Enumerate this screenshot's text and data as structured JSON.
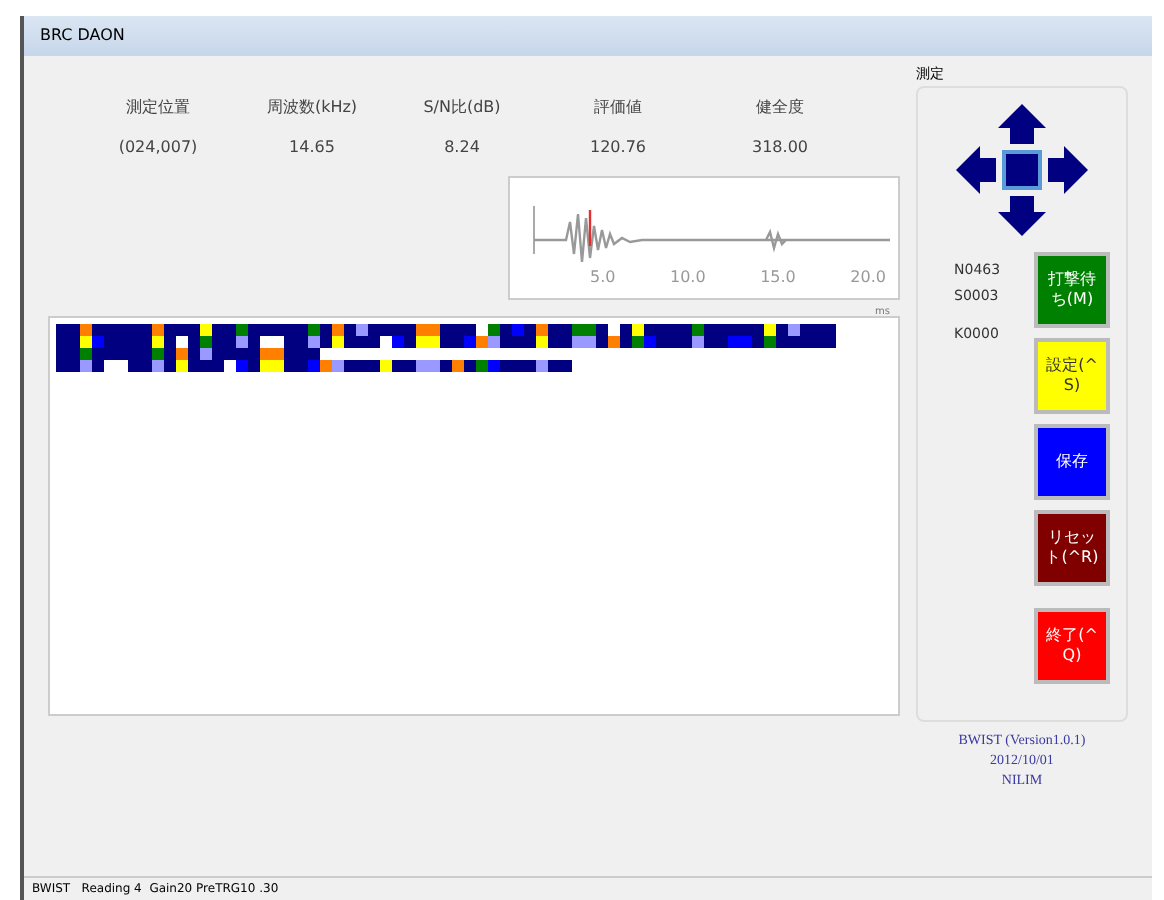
{
  "window": {
    "title": "BRC DAON"
  },
  "measurements": [
    {
      "label": "測定位置",
      "value": "(024,007)"
    },
    {
      "label": "周波数(kHz)",
      "value": "14.65"
    },
    {
      "label": "S/N比(dB)",
      "value": "8.24"
    },
    {
      "label": "評価値",
      "value": "120.76"
    },
    {
      "label": "健全度",
      "value": "318.00"
    }
  ],
  "waveform": {
    "xticks": [
      "5.0",
      "10.0",
      "15.0",
      "20.0"
    ],
    "unit": "ms"
  },
  "panel": {
    "title": "測定",
    "counters": [
      "N0463",
      "S0003",
      "K0000"
    ],
    "buttons": [
      {
        "label": "打撃待ち(M)",
        "color": "#008000"
      },
      {
        "label": "設定(^S)",
        "color": "#ffff00"
      },
      {
        "label": "保存",
        "color": "#0000ff"
      },
      {
        "label": "リセット(^R)",
        "color": "#800000"
      },
      {
        "label": "終了(^Q)",
        "color": "#ff0000"
      }
    ]
  },
  "about": [
    "BWIST (Version1.0.1)",
    "2012/10/01",
    "NILIM"
  ],
  "status_bar": "BWIST   Reading 4  Gain20 PreTRG10 .30"
}
